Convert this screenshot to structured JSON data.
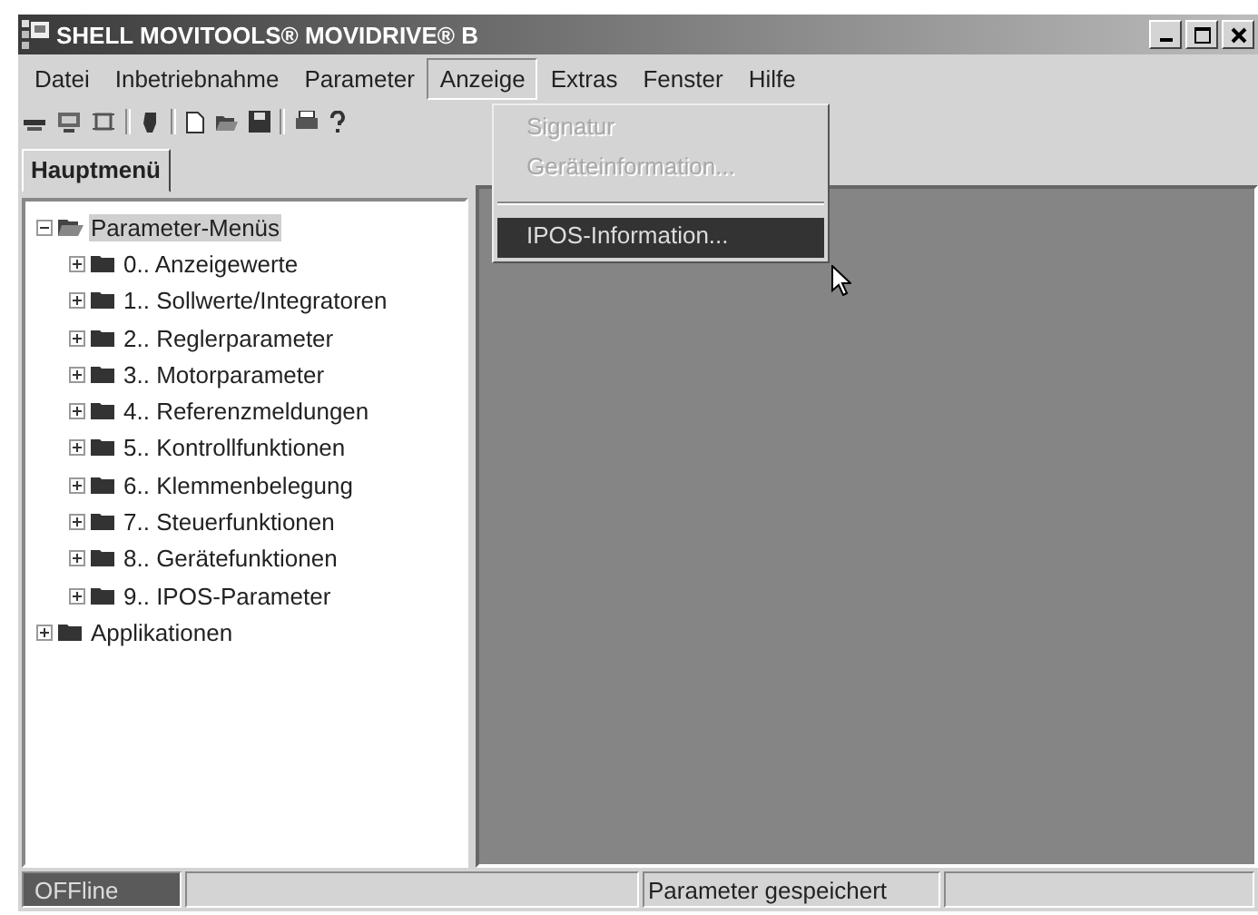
{
  "window": {
    "title": "SHELL MOVITOOLS® MOVIDRIVE® B"
  },
  "menu_bar": [
    {
      "label": "Datei",
      "selected": false
    },
    {
      "label": "Inbetriebnahme",
      "selected": false
    },
    {
      "label": "Parameter",
      "selected": false
    },
    {
      "label": "Anzeige",
      "selected": true
    },
    {
      "label": "Extras",
      "selected": false
    },
    {
      "label": "Fenster",
      "selected": false
    },
    {
      "label": "Hilfe",
      "selected": false
    }
  ],
  "dropdown": {
    "items": [
      {
        "kind": "item",
        "label": "Signatur",
        "disabled": true,
        "selected": false
      },
      {
        "kind": "item",
        "label": "Geräteinformation...",
        "disabled": true,
        "selected": false
      },
      {
        "kind": "separator"
      },
      {
        "kind": "item",
        "label": "IPOS-Information...",
        "disabled": false,
        "selected": true
      }
    ]
  },
  "tabs": [
    {
      "label": "Hauptmenü",
      "selected": true
    }
  ],
  "tree": [
    {
      "label": "Parameter-Menüs",
      "expanded": true,
      "selected": true,
      "children": [
        {
          "label": "0.. Anzeigewerte",
          "expanded": false,
          "selected": false
        },
        {
          "label": "1.. Sollwerte/Integratoren",
          "expanded": false,
          "selected": false
        },
        {
          "label": "2.. Reglerparameter",
          "expanded": false,
          "selected": false
        },
        {
          "label": "3.. Motorparameter",
          "expanded": false,
          "selected": false
        },
        {
          "label": "4.. Referenzmeldungen",
          "expanded": false,
          "selected": false
        },
        {
          "label": "5.. Kontrollfunktionen",
          "expanded": false,
          "selected": false
        },
        {
          "label": "6.. Klemmenbelegung",
          "expanded": false,
          "selected": false
        },
        {
          "label": "7.. Steuerfunktionen",
          "expanded": false,
          "selected": false
        },
        {
          "label": "8.. Gerätefunktionen",
          "expanded": false,
          "selected": false
        },
        {
          "label": "9.. IPOS-Parameter",
          "expanded": false,
          "selected": false
        }
      ]
    },
    {
      "label": "Applikationen",
      "expanded": false,
      "selected": false
    }
  ],
  "status_bar": {
    "connection": "OFFline",
    "message": "Parameter gespeichert"
  }
}
